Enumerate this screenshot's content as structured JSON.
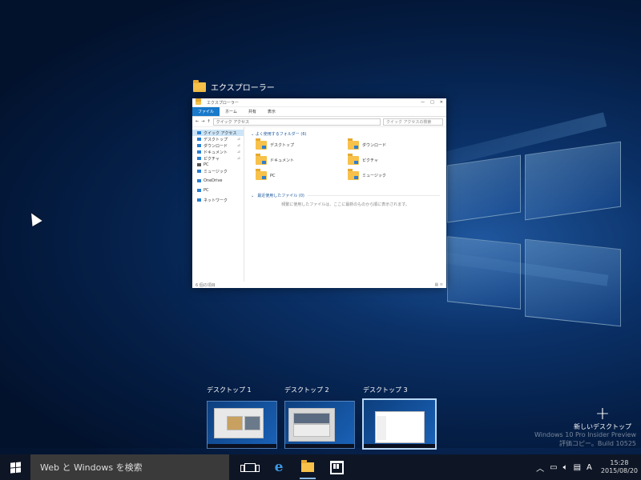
{
  "window": {
    "title": "エクスプローラー",
    "explorer_title": "エクスプローラー",
    "ribbon_tabs": [
      "ファイル",
      "ホーム",
      "共有",
      "表示"
    ],
    "address": "クイック アクセス",
    "search_placeholder": "クイック アクセスの検索",
    "nav_items": [
      "クイック アクセス",
      "デスクトップ",
      "ダウンロード",
      "ドキュメント",
      "ピクチャ",
      "PC",
      "ミュージック",
      "OneDrive",
      "PC",
      "ネットワーク"
    ],
    "frequent_header": "よく使用するフォルダー (6)",
    "folders": [
      "デスクトップ",
      "ダウンロード",
      "ドキュメント",
      "ピクチャ",
      "PC",
      "ミュージック"
    ],
    "recent_header": "最近使用したファイル (0)",
    "recent_empty": "頻繁に使用したファイルは、ここに最新のものから順に表示されます。",
    "status": "6 個の項目"
  },
  "desktops": [
    {
      "label": "デスクトップ 1"
    },
    {
      "label": "デスクトップ 2"
    },
    {
      "label": "デスクトップ 3"
    }
  ],
  "new_desktop": {
    "plus": "+",
    "label": "新しいデスクトップ"
  },
  "watermark": {
    "line1": "Windows 10 Pro Insider Preview",
    "line2": "評価コピー。Build 10525"
  },
  "taskbar": {
    "search_placeholder": "Web と Windows を検索",
    "ime": "A",
    "time": "15:28",
    "date": "2015/08/20"
  },
  "colors": {
    "accent": "#1979ca",
    "taskbar": "#0e1626",
    "folder": "#f7c14a"
  }
}
